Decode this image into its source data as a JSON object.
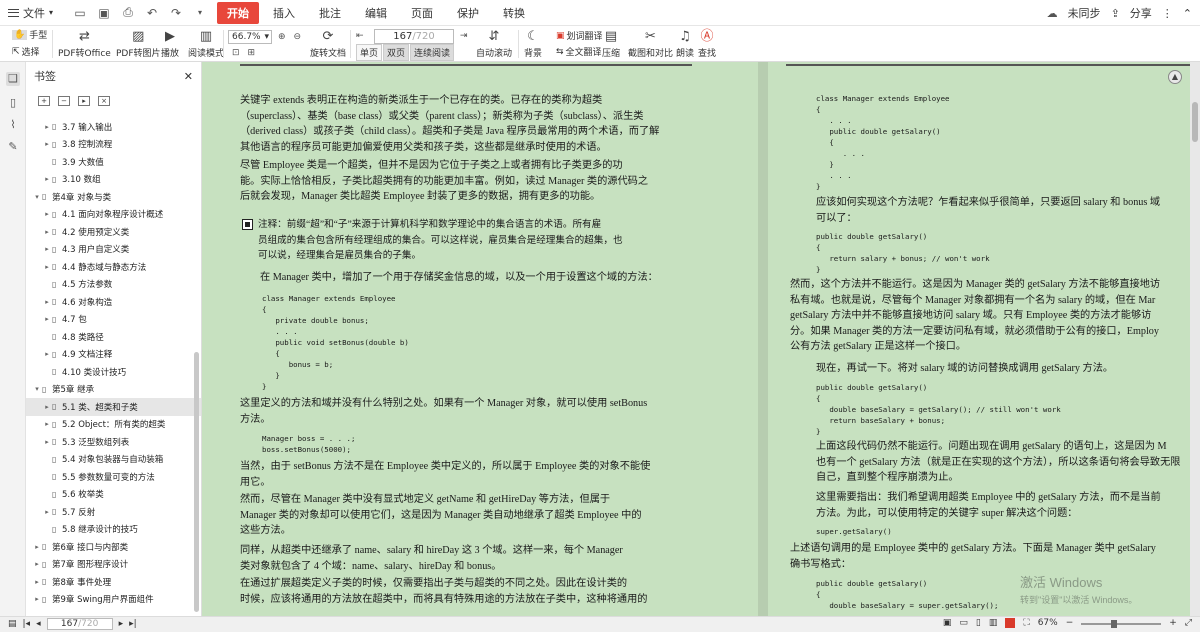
{
  "menubar": {
    "file": "文件",
    "tabs": [
      "开始",
      "插入",
      "批注",
      "编辑",
      "页面",
      "保护",
      "转换"
    ],
    "active_tab": "开始",
    "sync": "未同步",
    "share": "分享",
    "accent": "#e8473b"
  },
  "ribbon": {
    "hand": "手型",
    "select": "选择",
    "pdf_to_office": "PDF转Office",
    "pdf_to_image": "PDF转图片",
    "play": "播放",
    "read_mode": "阅读模式",
    "zoom": "66.7%",
    "rotate": "旋转文档",
    "single": "单页",
    "double": "双页",
    "continuous": "连续阅读",
    "auto_scroll": "自动滚动",
    "page_current": "167",
    "page_total": "/720",
    "background": "背景",
    "translate": "划词翻译",
    "full_translate": "全文翻译",
    "compress": "压缩",
    "screenshot": "截图和对比",
    "read_aloud": "朗读",
    "search": "查找"
  },
  "panel": {
    "title": "书签",
    "items": [
      {
        "label": "3.7 输入输出",
        "level": 2,
        "arrow": "▸"
      },
      {
        "label": "3.8 控制流程",
        "level": 2,
        "arrow": "▸"
      },
      {
        "label": "3.9 大数值",
        "level": 2,
        "arrow": ""
      },
      {
        "label": "3.10 数组",
        "level": 2,
        "arrow": "▸"
      },
      {
        "label": "第4章 对象与类",
        "level": 1,
        "arrow": "▾"
      },
      {
        "label": "4.1 面向对象程序设计概述",
        "level": 2,
        "arrow": "▸"
      },
      {
        "label": "4.2 使用预定义类",
        "level": 2,
        "arrow": "▸"
      },
      {
        "label": "4.3 用户自定义类",
        "level": 2,
        "arrow": "▸"
      },
      {
        "label": "4.4 静态域与静态方法",
        "level": 2,
        "arrow": "▸"
      },
      {
        "label": "4.5 方法参数",
        "level": 2,
        "arrow": ""
      },
      {
        "label": "4.6 对象构造",
        "level": 2,
        "arrow": "▸"
      },
      {
        "label": "4.7 包",
        "level": 2,
        "arrow": "▸"
      },
      {
        "label": "4.8 类路径",
        "level": 2,
        "arrow": ""
      },
      {
        "label": "4.9 文档注释",
        "level": 2,
        "arrow": "▸"
      },
      {
        "label": "4.10 类设计技巧",
        "level": 2,
        "arrow": ""
      },
      {
        "label": "第5章 继承",
        "level": 1,
        "arrow": "▾"
      },
      {
        "label": "5.1 类、超类和子类",
        "level": 2,
        "arrow": "▸",
        "selected": true
      },
      {
        "label": "5.2 Object：所有类的超类",
        "level": 2,
        "arrow": "▸"
      },
      {
        "label": "5.3 泛型数组列表",
        "level": 2,
        "arrow": "▸"
      },
      {
        "label": "5.4 对象包装器与自动装箱",
        "level": 2,
        "arrow": ""
      },
      {
        "label": "5.5 参数数量可变的方法",
        "level": 2,
        "arrow": ""
      },
      {
        "label": "5.6 枚举类",
        "level": 2,
        "arrow": ""
      },
      {
        "label": "5.7 反射",
        "level": 2,
        "arrow": "▸"
      },
      {
        "label": "5.8 继承设计的技巧",
        "level": 2,
        "arrow": ""
      },
      {
        "label": "第6章 接口与内部类",
        "level": 1,
        "arrow": "▸"
      },
      {
        "label": "第7章 图形程序设计",
        "level": 1,
        "arrow": "▸"
      },
      {
        "label": "第8章 事件处理",
        "level": 1,
        "arrow": "▸"
      },
      {
        "label": "第9章 Swing用户界面组件",
        "level": 1,
        "arrow": "▸"
      }
    ]
  },
  "left_page": {
    "p1": "关键字 extends 表明正在构造的新类派生于一个已存在的类。已存在的类称为超类\n（superclass）、基类（base class）或父类（parent class）；新类称为子类（subclass）、派生类\n（derived class）或孩子类（child class）。超类和子类是 Java 程序员最常用的两个术语，而了解\n其他语言的程序员可能更加偏爱使用父类和孩子类，这些都是继承时使用的术语。",
    "p2": "尽管 Employee 类是一个超类，但并不是因为它位于子类之上或者拥有比子类更多的功\n能。实际上恰恰相反，子类比超类拥有的功能更加丰富。例如，读过 Manager 类的源代码之\n后就会发现，Manager 类比超类 Employee 封装了更多的数据，拥有更多的功能。",
    "note": "注释：前缀“超”和“子”来源于计算机科学和数学理论中的集合语言的术语。所有雇\n员组成的集合包含所有经理组成的集合。可以这样说，雇员集合是经理集合的超集，也\n可以说，经理集合是雇员集合的子集。",
    "p3": "在 Manager 类中，增加了一个用于存储奖金信息的域，以及一个用于设置这个域的方法：",
    "code1": "class Manager extends Employee\n{\n   private double bonus;\n   . . .\n   public void setBonus(double b)\n   {\n      bonus = b;\n   }\n}",
    "p4": "这里定义的方法和域并没有什么特别之处。如果有一个 Manager 对象，就可以使用 setBonus\n方法。",
    "code2": "Manager boss = . . .;\nboss.setBonus(5000);",
    "p5": "当然，由于 setBonus 方法不是在 Employee 类中定义的，所以属于 Employee 类的对象不能使\n用它。",
    "p6": "然而，尽管在 Manager 类中没有显式地定义 getName 和 getHireDay 等方法，但属于\nManager 类的对象却可以使用它们，这是因为 Manager 类自动地继承了超类 Employee 中的\n这些方法。",
    "p7": "同样，从超类中还继承了 name、salary 和 hireDay 这 3 个域。这样一来，每个 Manager\n类对象就包含了 4 个域：name、salary、hireDay 和 bonus。",
    "p8": "在通过扩展超类定义子类的时候，仅需要指出子类与超类的不同之处。因此在设计类的\n时候，应该将通用的方法放在超类中，而将具有特殊用途的方法放在子类中，这种将通用的"
  },
  "right_page": {
    "code1": "class Manager extends Employee\n{\n   . . .\n   public double getSalary()\n   {\n      . . .\n   }\n   . . .\n}",
    "p1": "应该如何实现这个方法呢？乍看起来似乎很简单，只要返回 salary 和 bonus 域\n可以了：",
    "code2": "public double getSalary()\n{\n   return salary + bonus; // won't work\n}",
    "p2": "然而，这个方法并不能运行。这是因为 Manager 类的 getSalary 方法不能够直接地访\n私有域。也就是说，尽管每个 Manager 对象都拥有一个名为 salary 的域，但在 Mar\ngetSalary 方法中并不能够直接地访问 salary 域。只有 Employee 类的方法才能够访\n分。如果 Manager 类的方法一定要访问私有域，就必须借助于公有的接口，Employ\n公有方法 getSalary 正是这样一个接口。",
    "p3": "现在，再试一下。将对 salary 域的访问替换成调用 getSalary 方法。",
    "code3": "public double getSalary()\n{\n   double baseSalary = getSalary(); // still won't work\n   return baseSalary + bonus;\n}",
    "p4": "上面这段代码仍然不能运行。问题出现在调用 getSalary 的语句上，这是因为 M\n也有一个 getSalary 方法（就是正在实现的这个方法），所以这条语句将会导致无限\n自己，直到整个程序崩溃为止。",
    "p5": "这里需要指出：我们希望调用超类 Employee 中的 getSalary 方法，而不是当前\n方法。为此，可以使用特定的关键字 super 解决这个问题：",
    "code4": "super.getSalary()",
    "p6": "上述语句调用的是 Employee 类中的 getSalary 方法。下面是 Manager 类中 getSalary\n确书写格式：",
    "code5": "public double getSalary()\n{\n   double baseSalary = super.getSalary();"
  },
  "watermark": {
    "line1": "激活 Windows",
    "line2": "转到\"设置\"以激活 Windows。"
  },
  "status": {
    "page_current": "167",
    "page_total": "/720",
    "zoom": "67%"
  },
  "colors": {
    "page_bg": "#c7e1c0",
    "accent": "#e8473b"
  }
}
